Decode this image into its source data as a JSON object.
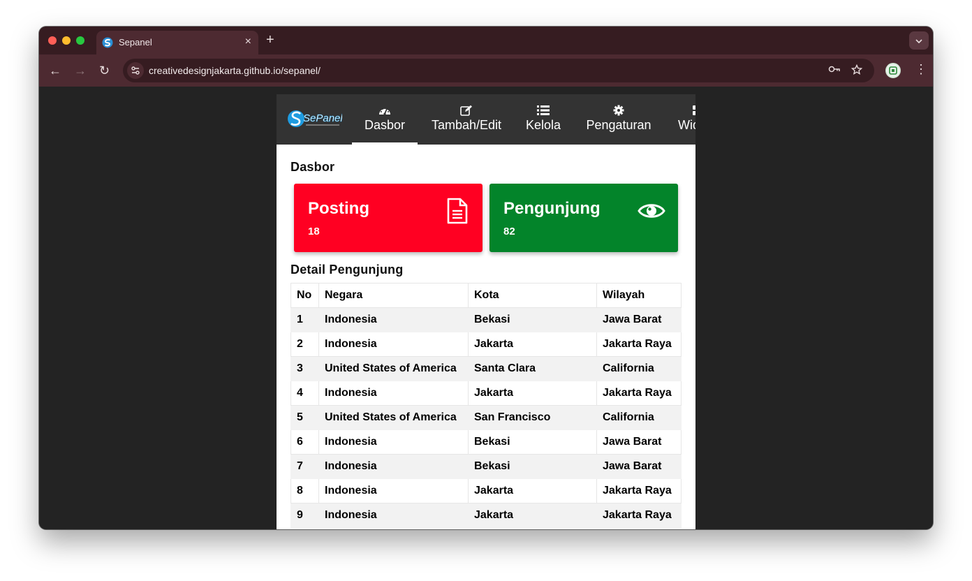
{
  "browser": {
    "tab_title": "Sepanel",
    "tab_close": "×",
    "new_tab": "+",
    "url": "creativedesignjakarta.github.io/sepanel/",
    "back": "←",
    "forward": "→",
    "reload": "↻",
    "menu": "⋮"
  },
  "app": {
    "logo_text": "SePanel",
    "nav": [
      {
        "label": "Dasbor",
        "icon": "tachometer-icon"
      },
      {
        "label": "Tambah/Edit",
        "icon": "edit-icon"
      },
      {
        "label": "Kelola",
        "icon": "list-icon"
      },
      {
        "label": "Pengaturan",
        "icon": "gear-icon"
      },
      {
        "label": "Widget",
        "icon": "widget-icon"
      }
    ],
    "page_title": "Dasbor",
    "cards": [
      {
        "title": "Posting",
        "count": "18",
        "icon": "file-icon",
        "color": "#ff0022"
      },
      {
        "title": "Pengunjung",
        "count": "82",
        "icon": "eye-icon",
        "color": "#03842a"
      }
    ],
    "detail_title": "Detail Pengunjung",
    "table": {
      "headers": [
        "No",
        "Negara",
        "Kota",
        "Wilayah"
      ],
      "rows": [
        [
          "1",
          "Indonesia",
          "Bekasi",
          "Jawa Barat"
        ],
        [
          "2",
          "Indonesia",
          "Jakarta",
          "Jakarta Raya"
        ],
        [
          "3",
          "United States of America",
          "Santa Clara",
          "California"
        ],
        [
          "4",
          "Indonesia",
          "Jakarta",
          "Jakarta Raya"
        ],
        [
          "5",
          "United States of America",
          "San Francisco",
          "California"
        ],
        [
          "6",
          "Indonesia",
          "Bekasi",
          "Jawa Barat"
        ],
        [
          "7",
          "Indonesia",
          "Bekasi",
          "Jawa Barat"
        ],
        [
          "8",
          "Indonesia",
          "Jakarta",
          "Jakarta Raya"
        ],
        [
          "9",
          "Indonesia",
          "Jakarta",
          "Jakarta Raya"
        ]
      ]
    }
  }
}
